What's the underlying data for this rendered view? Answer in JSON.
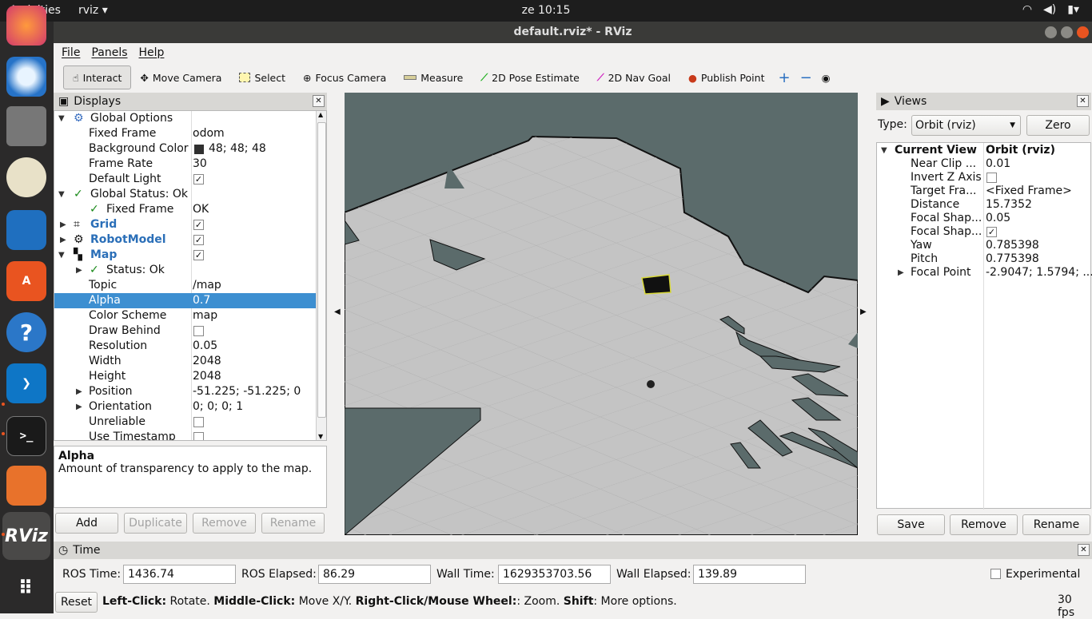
{
  "topbar": {
    "activities": "Activities",
    "app": "rviz ▾",
    "clock": "ze 10:15"
  },
  "window": {
    "title": "default.rviz* - RViz"
  },
  "menu": {
    "file": "File",
    "panels": "Panels",
    "help": "Help"
  },
  "toolbar": {
    "interact": "Interact",
    "move_camera": "Move Camera",
    "select": "Select",
    "focus_camera": "Focus Camera",
    "measure": "Measure",
    "pose_estimate": "2D Pose Estimate",
    "nav_goal": "2D Nav Goal",
    "publish_point": "Publish Point"
  },
  "displays": {
    "title": "Displays",
    "global_options": "Global Options",
    "fixed_frame_k": "Fixed Frame",
    "fixed_frame_v": "odom",
    "bg_color_k": "Background Color",
    "bg_color_v": "48; 48; 48",
    "frame_rate_k": "Frame Rate",
    "frame_rate_v": "30",
    "default_light_k": "Default Light",
    "global_status": "Global Status: Ok",
    "gs_fixed_frame_k": "Fixed Frame",
    "gs_fixed_frame_v": "OK",
    "grid": "Grid",
    "robot_model": "RobotModel",
    "map": "Map",
    "map_status": "Status: Ok",
    "topic_k": "Topic",
    "topic_v": "/map",
    "alpha_k": "Alpha",
    "alpha_v": "0.7",
    "color_scheme_k": "Color Scheme",
    "color_scheme_v": "map",
    "draw_behind_k": "Draw Behind",
    "resolution_k": "Resolution",
    "resolution_v": "0.05",
    "width_k": "Width",
    "width_v": "2048",
    "height_k": "Height",
    "height_v": "2048",
    "position_k": "Position",
    "position_v": "-51.225; -51.225; 0",
    "orientation_k": "Orientation",
    "orientation_v": "0; 0; 0; 1",
    "unreliable_k": "Unreliable",
    "use_timestamp_k": "Use Timestamp"
  },
  "description": {
    "title": "Alpha",
    "text": "Amount of transparency to apply to the map."
  },
  "display_buttons": {
    "add": "Add",
    "duplicate": "Duplicate",
    "remove": "Remove",
    "rename": "Rename"
  },
  "views": {
    "title": "Views",
    "type_label": "Type:",
    "type_value": "Orbit (rviz)",
    "zero": "Zero",
    "current_view_k": "Current View",
    "current_view_v": "Orbit (rviz)",
    "near_clip_k": "Near Clip ...",
    "near_clip_v": "0.01",
    "invert_z_k": "Invert Z Axis",
    "target_frame_k": "Target Fra...",
    "target_frame_v": "<Fixed Frame>",
    "distance_k": "Distance",
    "distance_v": "15.7352",
    "focal_shape_size_k": "Focal Shap...",
    "focal_shape_size_v": "0.05",
    "focal_shape_fixed_k": "Focal Shap...",
    "yaw_k": "Yaw",
    "yaw_v": "0.785398",
    "pitch_k": "Pitch",
    "pitch_v": "0.775398",
    "focal_point_k": "Focal Point",
    "focal_point_v": "-2.9047; 1.5794; ...",
    "save": "Save",
    "remove": "Remove",
    "rename": "Rename"
  },
  "time": {
    "title": "Time",
    "ros_time_label": "ROS Time:",
    "ros_time": "1436.74",
    "ros_elapsed_label": "ROS Elapsed:",
    "ros_elapsed": "86.29",
    "wall_time_label": "Wall Time:",
    "wall_time": "1629353703.56",
    "wall_elapsed_label": "Wall Elapsed:",
    "wall_elapsed": "139.89",
    "experimental": "Experimental"
  },
  "status": {
    "reset": "Reset",
    "left_click": "Left-Click:",
    "left_desc": " Rotate. ",
    "middle_click": "Middle-Click:",
    "middle_desc": " Move X/Y. ",
    "right_click": "Right-Click/Mouse Wheel:",
    "right_desc": ": Zoom. ",
    "shift": "Shift",
    "shift_desc": ": More options.",
    "fps": "30 fps"
  },
  "colors": {
    "accent": "#3d8fd1",
    "background_swatch": "#303030",
    "map_free": "#c4c4c4",
    "map_unknown": "#5b6b6b"
  }
}
